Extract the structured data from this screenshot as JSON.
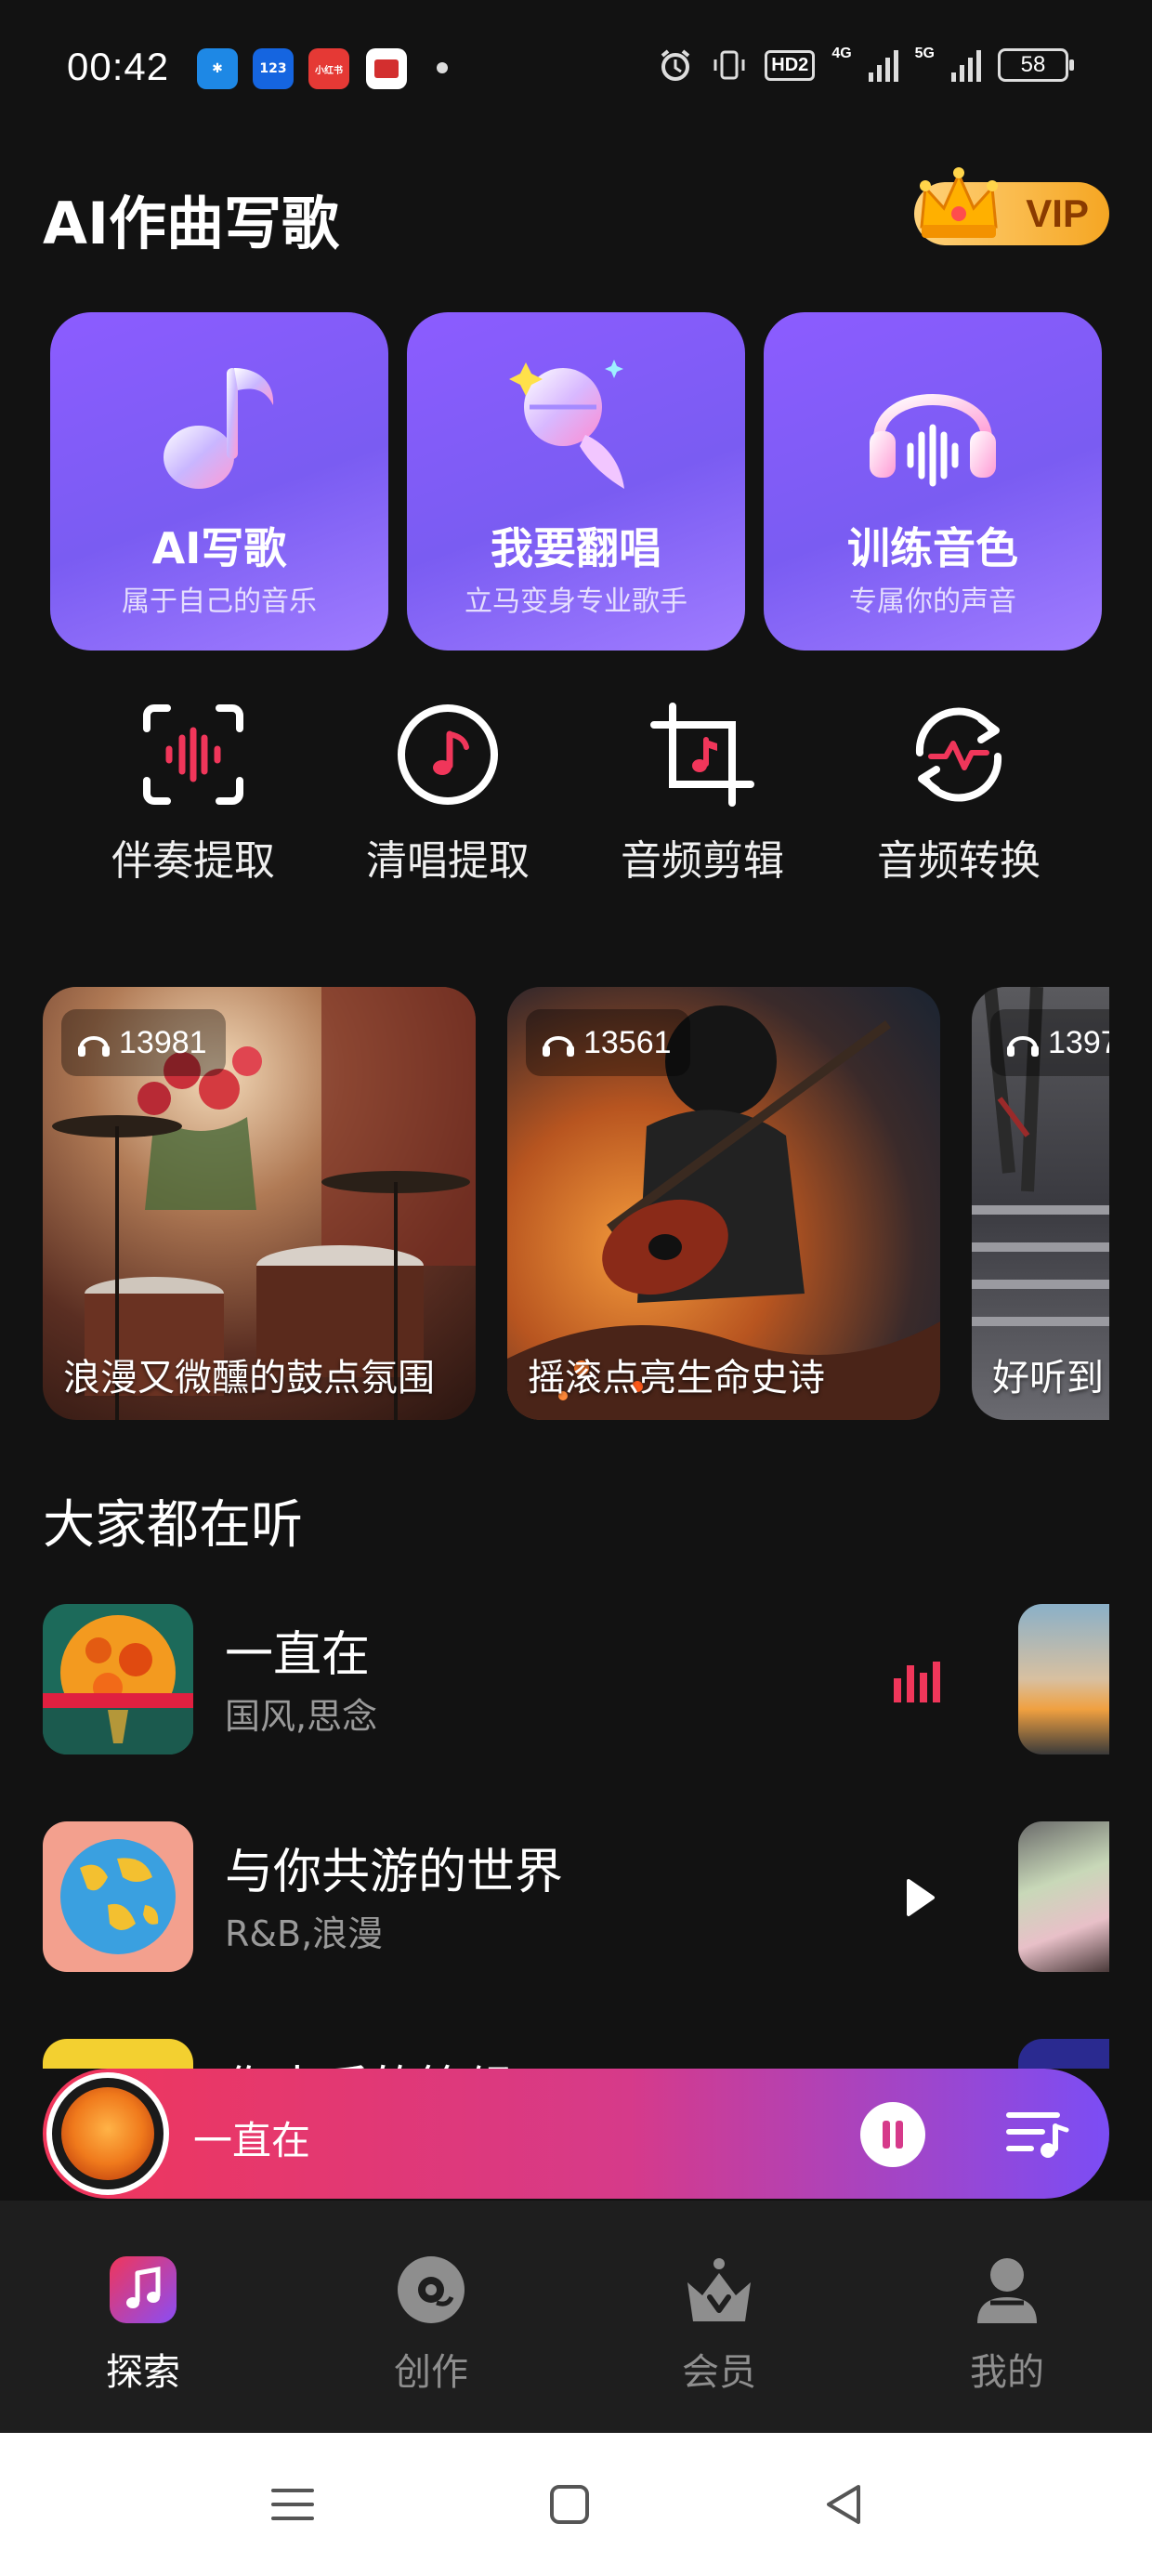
{
  "status_bar": {
    "time": "00:42",
    "notifications": [
      {
        "icon": "app-bird-icon",
        "color": "#1e88e5",
        "text": "✱"
      },
      {
        "icon": "app-123-icon",
        "color": "#1565e0",
        "text": "123"
      },
      {
        "icon": "xiaohongshu-icon",
        "color": "#e53935",
        "text": "小红书"
      },
      {
        "icon": "news-app-icon",
        "color": "#d32f2f",
        "text": ""
      }
    ],
    "hd_label": "HD2",
    "net1": "4G",
    "net2": "5G",
    "battery": "58"
  },
  "header": {
    "title": "AI作曲写歌",
    "vip_label": "VIP"
  },
  "feature_cards": [
    {
      "title": "AI写歌",
      "subtitle": "属于自己的音乐",
      "icon": "music-note-icon"
    },
    {
      "title": "我要翻唱",
      "subtitle": "立马变身专业歌手",
      "icon": "microphone-icon"
    },
    {
      "title": "训练音色",
      "subtitle": "专属你的声音",
      "icon": "headphones-icon"
    }
  ],
  "tools": [
    {
      "label": "伴奏提取",
      "icon": "waveform-scan-icon"
    },
    {
      "label": "清唱提取",
      "icon": "music-disc-icon"
    },
    {
      "label": "音频剪辑",
      "icon": "crop-music-icon"
    },
    {
      "label": "音频转换",
      "icon": "convert-pulse-icon"
    }
  ],
  "playlists": [
    {
      "count": "13981",
      "title": "浪漫又微醺的鼓点氛围"
    },
    {
      "count": "13561",
      "title": "摇滚点亮生命史诗"
    },
    {
      "count": "1397",
      "title": "好听到"
    }
  ],
  "section_title": "大家都在听",
  "songs": [
    {
      "name": "一直在",
      "tags": "国风,思念",
      "state": "playing"
    },
    {
      "name": "与你共游的世界",
      "tags": "R&B,浪漫",
      "state": "paused"
    },
    {
      "name": "你走后的等候",
      "tags": "",
      "state": ""
    }
  ],
  "player": {
    "song": "一直在"
  },
  "bottom_nav": [
    {
      "label": "探索",
      "icon": "explore-music-icon",
      "active": true
    },
    {
      "label": "创作",
      "icon": "create-disc-icon",
      "active": false
    },
    {
      "label": "会员",
      "icon": "crown-icon",
      "active": false
    },
    {
      "label": "我的",
      "icon": "profile-icon",
      "active": false
    }
  ],
  "colors": {
    "background": "#121212",
    "card_purple": "#8c5cff",
    "accent_red": "#f0365a",
    "vip_gold": "#f5a623"
  }
}
